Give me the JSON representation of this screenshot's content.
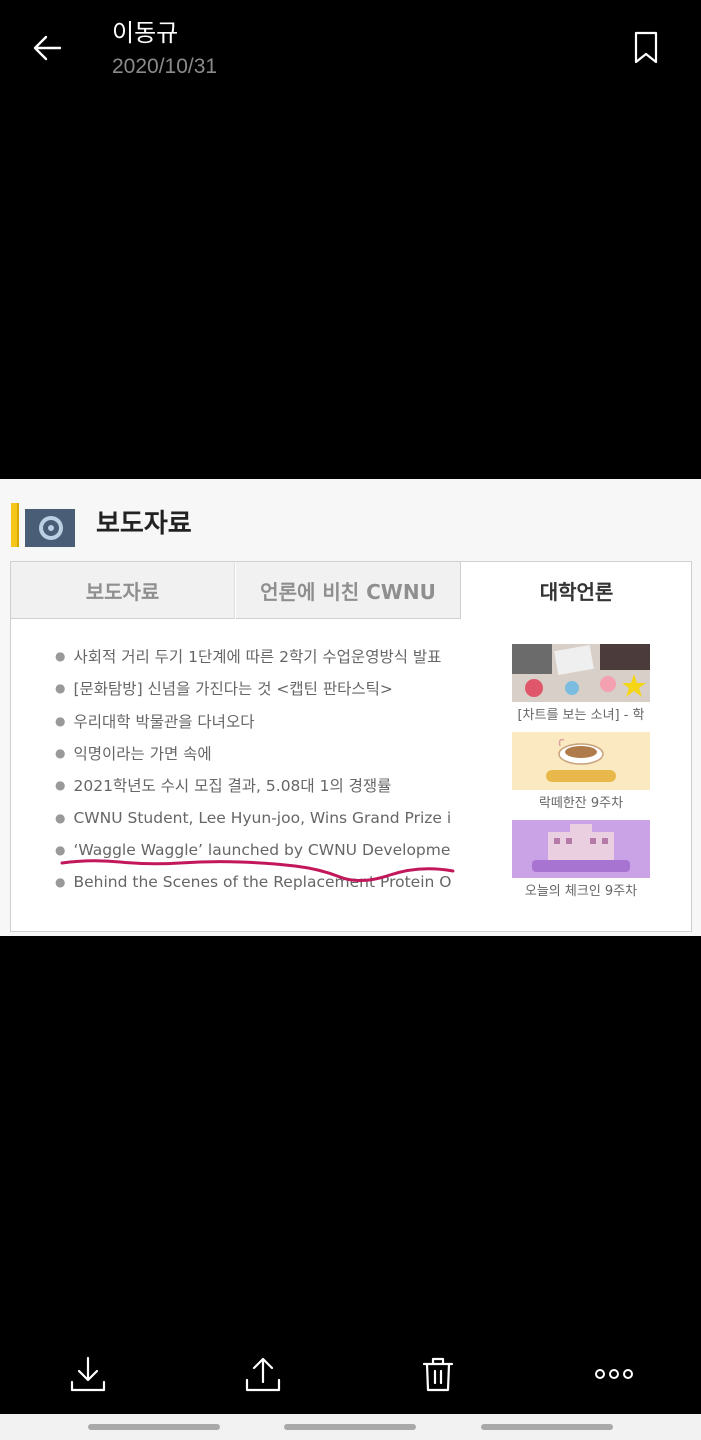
{
  "header": {
    "sender": "이동규",
    "date": "2020/10/31",
    "back_icon": "arrow-left-icon",
    "bookmark_icon": "bookmark-icon"
  },
  "image": {
    "title": "보도자료",
    "tabs": [
      "보도자료",
      "언론에 비친 CWNU",
      "대학언론"
    ],
    "active_tab": "대학언론",
    "news": [
      "사회적 거리 두기 1단계에 따른 2학기 수업운영방식 발표",
      "[문화탐방] 신념을 가진다는 것 <캡틴 판타스틱>",
      "우리대학 박물관을 다녀오다",
      "익명이라는 가면 속에",
      "2021학년도 수시 모집 결과, 5.08대 1의 경쟁률",
      "CWNU Student, Lee Hyun-joo, Wins Grand Prize in KT Contest",
      "‘Waggle Waggle’ launched by CWNU Development Team",
      "Behind the Scenes of the Replacement Protein Online Sys"
    ],
    "thumbnails": [
      {
        "caption": "[차트를 보는 소녀] - 학",
        "color": "#d8d0c8"
      },
      {
        "caption": "락떼한잔 9주차",
        "color": "#fbe9c2"
      },
      {
        "caption": "오늘의 체크인 9주차",
        "color": "#c9a3e6"
      }
    ],
    "underline_color": "#c2185b"
  },
  "toolbar": {
    "icons": [
      "download-icon",
      "share-icon",
      "delete-icon",
      "more-icon"
    ]
  }
}
